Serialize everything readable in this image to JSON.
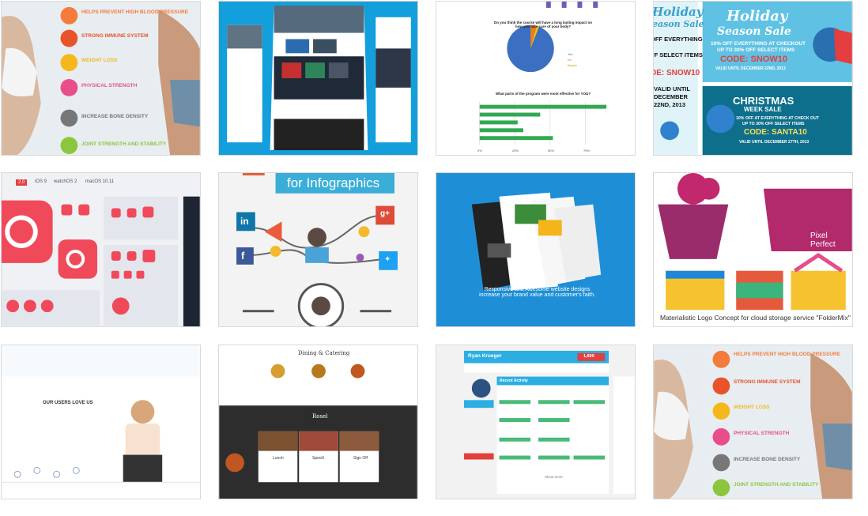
{
  "tiles": [
    {
      "id": "t1",
      "kind": "fitness-infographic",
      "items": [
        "HELPS PREVENT HIGH BLOOD PRESSURE",
        "STRONG IMMUNE SYSTEM",
        "WEIGHT LOSS",
        "PHYSICAL STRENGTH",
        "INCREASE BONE DENSITY",
        "JOINT STRENGTH AND STABILITY"
      ]
    },
    {
      "id": "t2",
      "kind": "website-mockup"
    },
    {
      "id": "t3",
      "kind": "survey-charts",
      "q1": "Do you think the course will have a long lasting impact on how you take care of your body?",
      "legend": [
        "Yes",
        "No",
        "Maybe"
      ],
      "q2": "What parts of the program were most effective for YOU?",
      "ticks": [
        "0%",
        "25%",
        "50%",
        "75%"
      ],
      "bars": [
        90,
        43,
        27,
        31,
        52
      ]
    },
    {
      "id": "t4",
      "kind": "holiday-sale",
      "left": {
        "lines": [
          "Holiday",
          "Season Sale",
          "OFF EVERYTHING",
          "FF SELECT ITEMS",
          "DE: SNOW10",
          "VALID UNTIL",
          "DECEMBER",
          "22ND, 2013"
        ]
      },
      "right_top": {
        "title1": "Holiday",
        "title2": "Season Sale",
        "offer": "10% OFF EVERYTHING AT CHECKOUT",
        "offer2": "UP TO 30% OFF SELECT ITEMS",
        "code": "CODE: SNOW10",
        "valid": "VALID UNTIL DECEMBER 22ND, 2013"
      },
      "right_bottom": {
        "title1": "CHRISTMAS",
        "title2": "WEEK SALE",
        "offer": "10% OFF AT EVERYTHING AT CHECK OUT",
        "offer2": "UP TO 30% OFF SELECT ITEMS",
        "code": "CODE: SANTA10",
        "valid": "VALID UNTIL DECEMBER 27TH, 2013"
      }
    },
    {
      "id": "t5",
      "kind": "app-icons",
      "tabs": [
        "2.0",
        "iOS 9",
        "watchOS 2",
        "macOS 10.11"
      ]
    },
    {
      "id": "t6",
      "kind": "social-infographic",
      "title": "for Infographics",
      "social": [
        "in",
        "g+",
        "f"
      ]
    },
    {
      "id": "t7",
      "kind": "web-designs",
      "caption": "Responsive and Awesome website designs increase your brand value and customer's faith."
    },
    {
      "id": "t8",
      "kind": "logo-concept",
      "badge": "Pixel Perfect",
      "caption": "Materialistic Logo Concept for cloud storage service \"FolderMix\""
    },
    {
      "id": "t9",
      "kind": "testimonial",
      "heading": "OUR USERS LOVE US"
    },
    {
      "id": "t10",
      "kind": "restaurant",
      "title": "Dining & Catering",
      "section": "Rosel",
      "menu": [
        "Lunch",
        "Specili",
        "Sign Off"
      ]
    },
    {
      "id": "t11",
      "kind": "dashboard",
      "name": "Ryan Krueger",
      "score": "1,890",
      "panel": "Recent Activity",
      "more": "Show more"
    },
    {
      "id": "t12",
      "kind": "fitness-infographic",
      "items": [
        "HELPS PREVENT HIGH BLOOD PRESSURE",
        "STRONG IMMUNE SYSTEM",
        "WEIGHT LOSS",
        "PHYSICAL STRENGTH",
        "INCREASE BONE DENSITY",
        "JOINT STRENGTH AND STABILITY"
      ]
    }
  ]
}
